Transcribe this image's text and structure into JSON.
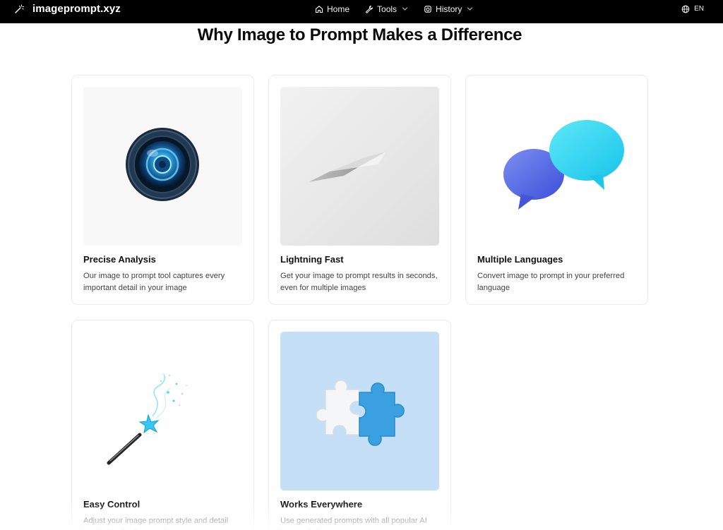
{
  "nav": {
    "brand": "imageprompt.xyz",
    "links": [
      {
        "label": "Home",
        "icon": "home-icon"
      },
      {
        "label": "Tools",
        "icon": "wrench-icon",
        "dropdown": true
      },
      {
        "label": "History",
        "icon": "history-icon",
        "dropdown": true
      }
    ],
    "language": "EN"
  },
  "section": {
    "title": "Why Image to Prompt Makes a Difference"
  },
  "features": [
    {
      "title": "Precise Analysis",
      "description": "Our image to prompt tool captures every important detail in your image",
      "image": "camera-lens-image"
    },
    {
      "title": "Lightning Fast",
      "description": "Get your image to prompt results in seconds, even for multiple images",
      "image": "paper-fold-image"
    },
    {
      "title": "Multiple Languages",
      "description": "Convert image to prompt in your preferred language",
      "image": "speech-bubbles-image"
    },
    {
      "title": "Easy Control",
      "description": "Adjust your image prompt style and detail level with simple controls",
      "image": "magic-wand-image"
    },
    {
      "title": "Works Everywhere",
      "description": "Use generated prompts with all popular AI image platforms",
      "image": "puzzle-pieces-image"
    }
  ],
  "colors": {
    "navbar_bg": "#000000",
    "bubble_blue": "#5c73ea",
    "bubble_cyan": "#2ed8f2",
    "puzzle_bg": "#c5e0f6",
    "puzzle_blue": "#3aa0e0"
  }
}
